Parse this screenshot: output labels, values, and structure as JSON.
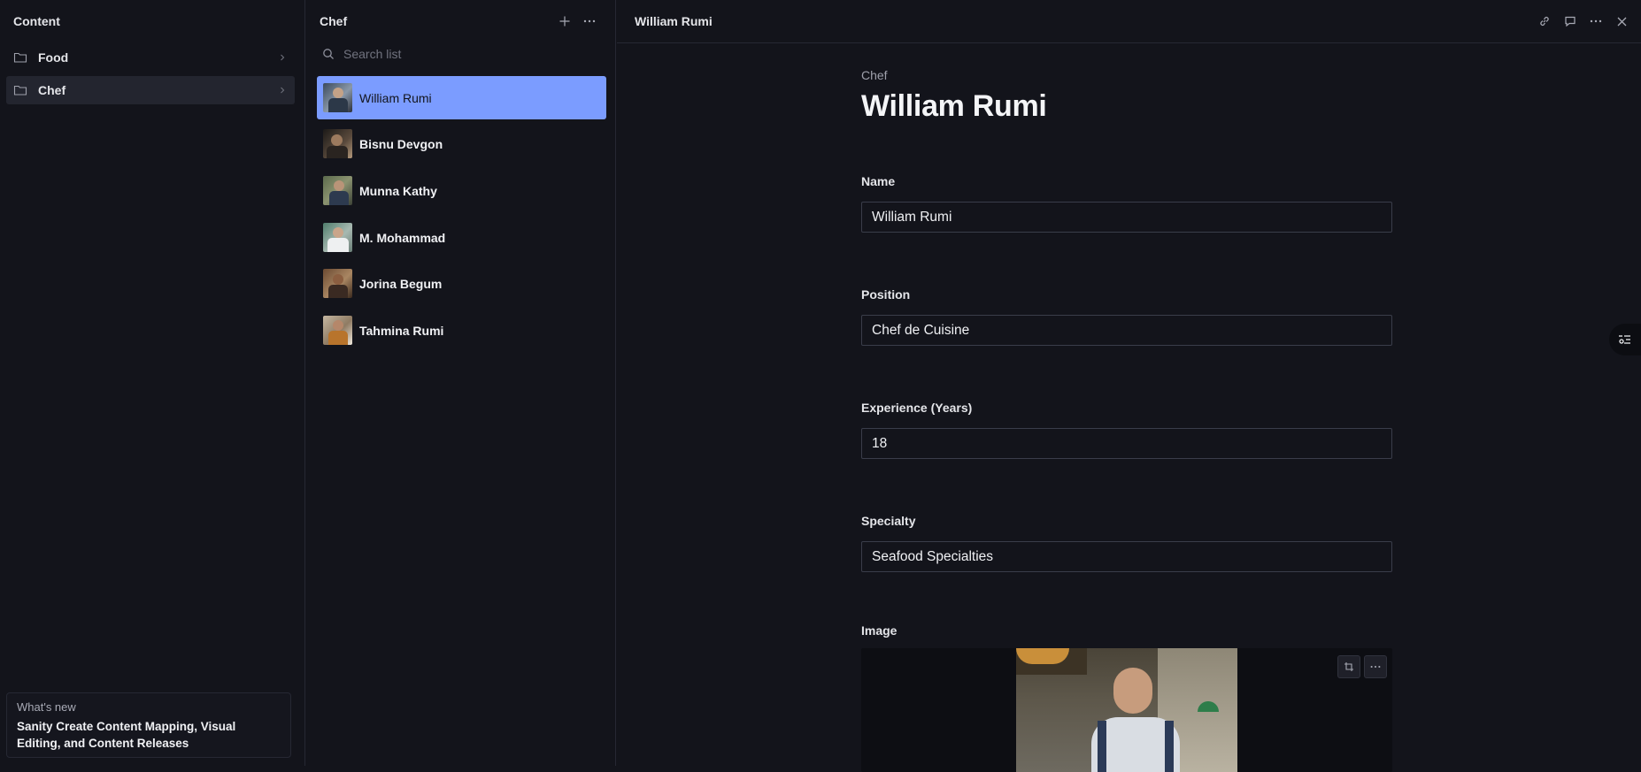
{
  "content_pane": {
    "title": "Content",
    "items": [
      {
        "label": "Food",
        "icon": "folder-icon"
      },
      {
        "label": "Chef",
        "icon": "folder-icon",
        "active": true
      }
    ],
    "whats_new": {
      "kicker": "What's new",
      "headline": "Sanity Create Content Mapping, Visual Editing, and Content Releases"
    }
  },
  "list_pane": {
    "title": "Chef",
    "search_placeholder": "Search list",
    "items": [
      {
        "name": "William Rumi",
        "active": true
      },
      {
        "name": "Bisnu Devgon"
      },
      {
        "name": "Munna Kathy"
      },
      {
        "name": "M. Mohammad"
      },
      {
        "name": "Jorina Begum"
      },
      {
        "name": "Tahmina Rumi"
      }
    ]
  },
  "document": {
    "header_title": "William Rumi",
    "type_label": "Chef",
    "title": "William Rumi",
    "fields": {
      "name": {
        "label": "Name",
        "value": "William Rumi"
      },
      "position": {
        "label": "Position",
        "value": "Chef de Cuisine"
      },
      "experience": {
        "label": "Experience (Years)",
        "value": "18"
      },
      "specialty": {
        "label": "Specialty",
        "value": "Seafood Specialties"
      },
      "image": {
        "label": "Image"
      }
    }
  },
  "colors": {
    "background": "#13141b",
    "accent": "#7b9cff",
    "border": "#262833"
  }
}
